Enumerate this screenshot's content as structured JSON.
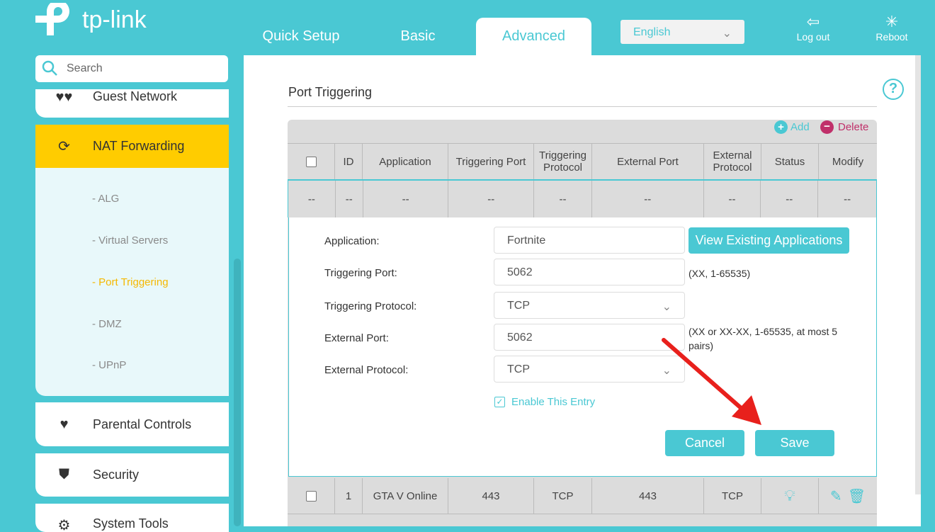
{
  "brand": "tp-link",
  "tabs": [
    {
      "label": "Quick Setup"
    },
    {
      "label": "Basic"
    },
    {
      "label": "Advanced"
    }
  ],
  "language": "English",
  "header_buttons": {
    "logout": "Log out",
    "reboot": "Reboot"
  },
  "search": {
    "placeholder": "Search"
  },
  "sidebar": {
    "guest": "Guest Network",
    "nat": "NAT Forwarding",
    "sub": [
      "- ALG",
      "- Virtual Servers",
      "- Port Triggering",
      "- DMZ",
      "- UPnP"
    ],
    "parental": "Parental Controls",
    "security": "Security",
    "system": "System Tools"
  },
  "page_title": "Port Triggering",
  "toolbar": {
    "add": "Add",
    "delete": "Delete"
  },
  "columns": [
    "ID",
    "Application",
    "Triggering Port",
    "Triggering Protocol",
    "External Port",
    "External Protocol",
    "Status",
    "Modify"
  ],
  "placeholder_row": [
    "--",
    "--",
    "--",
    "--",
    "--",
    "--",
    "--",
    "--",
    "--"
  ],
  "form": {
    "application_label": "Application:",
    "application_value": "Fortnite",
    "view_apps": "View Existing Applications",
    "trig_port_label": "Triggering Port:",
    "trig_port_value": "5062",
    "trig_port_hint": "(XX, 1-65535)",
    "trig_proto_label": "Triggering Protocol:",
    "trig_proto_value": "TCP",
    "ext_port_label": "External Port:",
    "ext_port_value": "5062",
    "ext_port_hint": "(XX or XX-XX, 1-65535, at most 5 pairs)",
    "ext_proto_label": "External Protocol:",
    "ext_proto_value": "TCP",
    "enable_label": "Enable This Entry",
    "enabled": true,
    "cancel": "Cancel",
    "save": "Save"
  },
  "rows": [
    {
      "id": "1",
      "application": "GTA V Online",
      "trig_port": "443",
      "trig_proto": "TCP",
      "ext_port": "443",
      "ext_proto": "TCP"
    }
  ],
  "colors": {
    "brand": "#4ac8d3",
    "active": "#ffcc00",
    "delete": "#c0306a",
    "arrow": "#e8201c"
  }
}
